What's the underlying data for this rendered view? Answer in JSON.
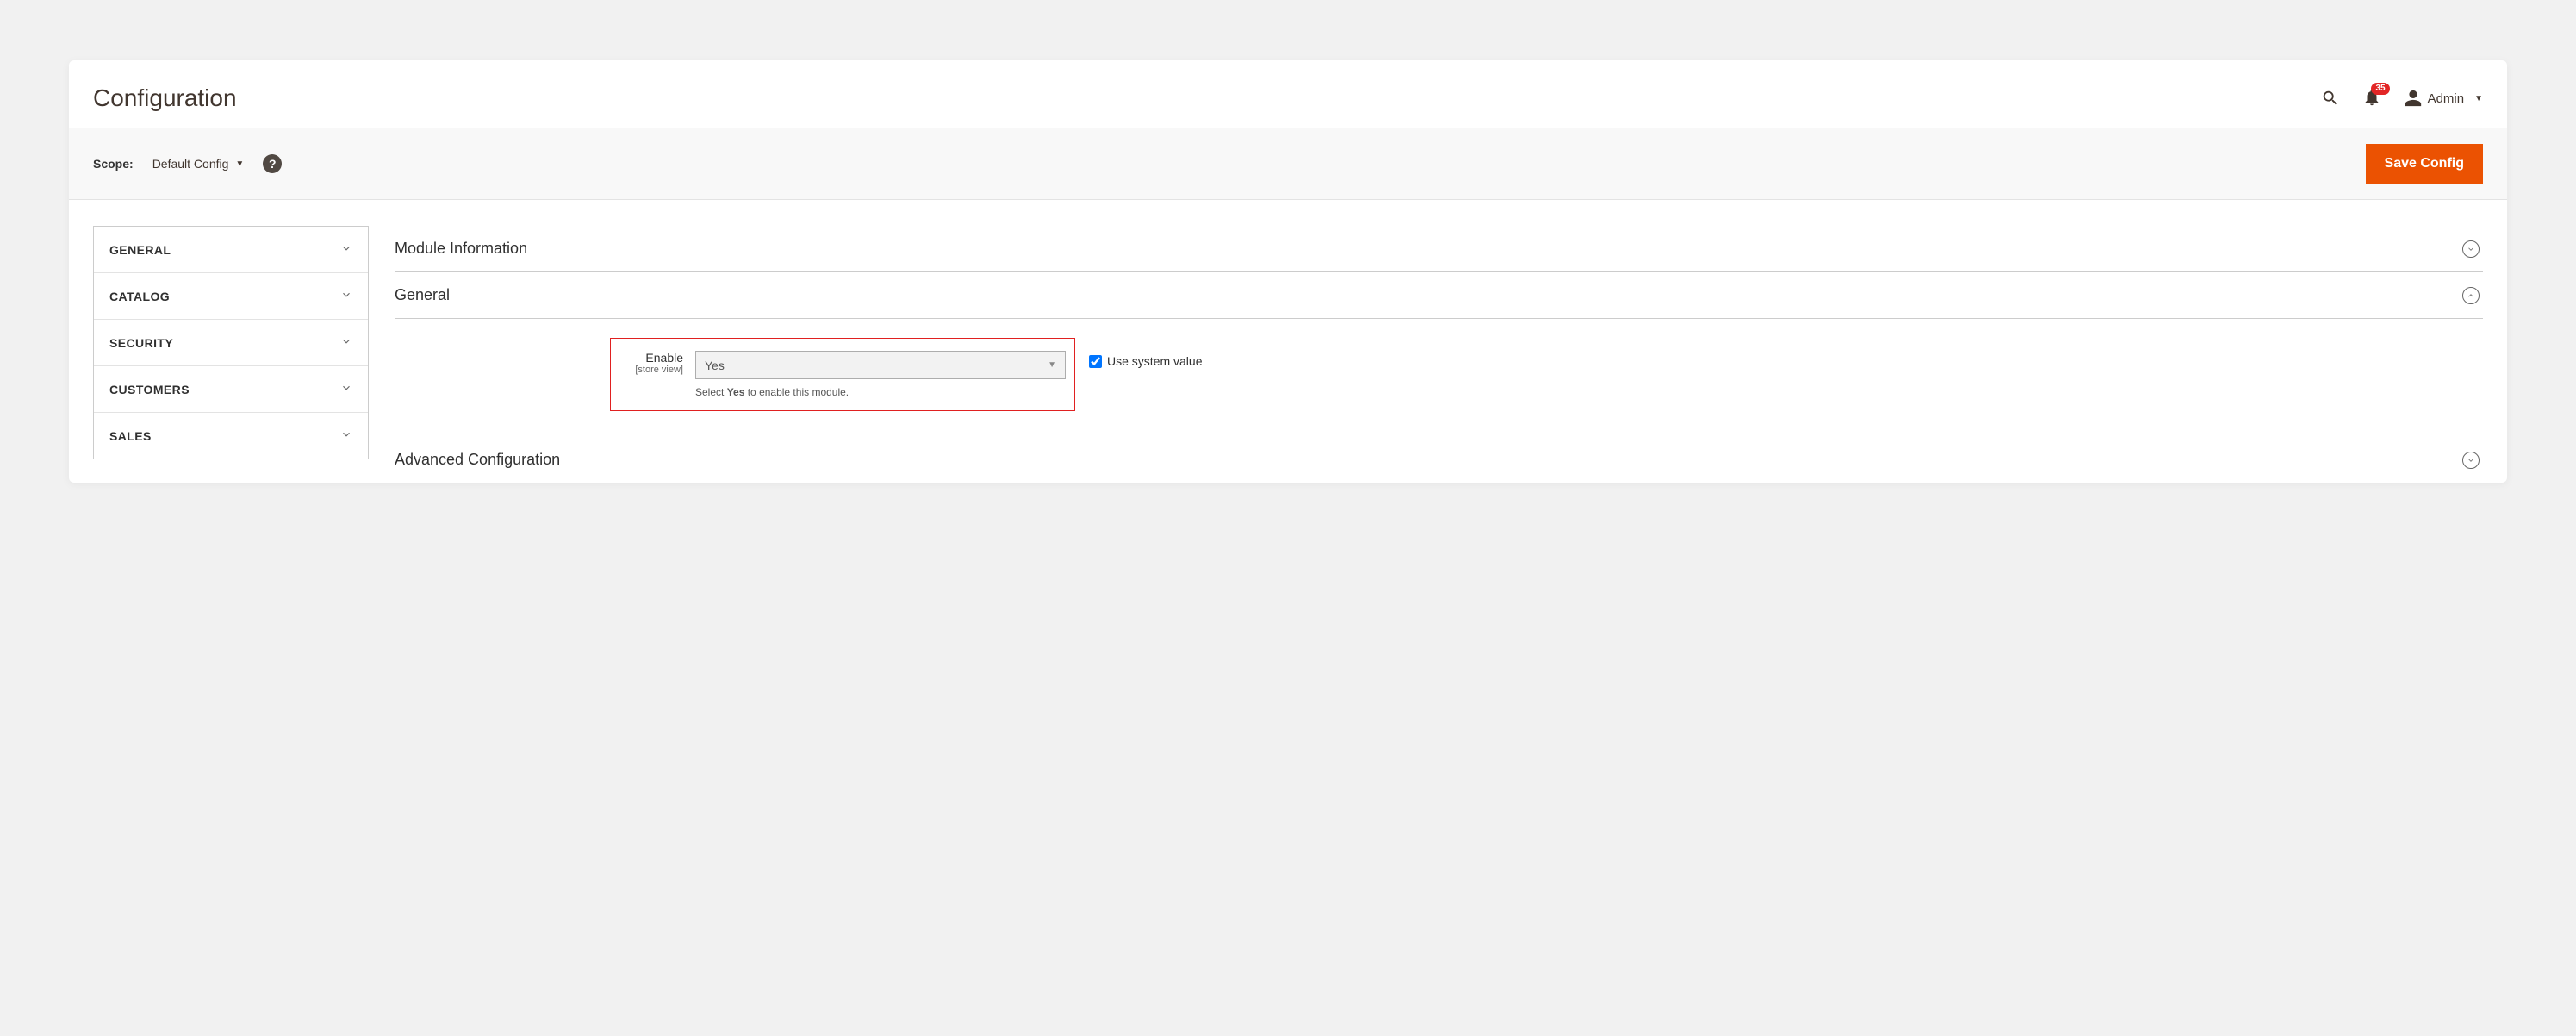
{
  "header": {
    "title": "Configuration",
    "notification_count": "35",
    "user_label": "Admin"
  },
  "scope": {
    "label": "Scope:",
    "value": "Default Config",
    "save_label": "Save Config"
  },
  "sidebar": {
    "items": [
      {
        "label": "GENERAL"
      },
      {
        "label": "CATALOG"
      },
      {
        "label": "SECURITY"
      },
      {
        "label": "CUSTOMERS"
      },
      {
        "label": "SALES"
      }
    ]
  },
  "sections": {
    "module_info": {
      "title": "Module Information"
    },
    "general": {
      "title": "General",
      "enable": {
        "label": "Enable",
        "sublabel": "[store view]",
        "value": "Yes",
        "note_pre": "Select ",
        "note_bold": "Yes",
        "note_post": " to enable this module.",
        "use_system_label": "Use system value",
        "use_system_checked": true
      }
    },
    "advanced": {
      "title": "Advanced Configuration"
    }
  }
}
